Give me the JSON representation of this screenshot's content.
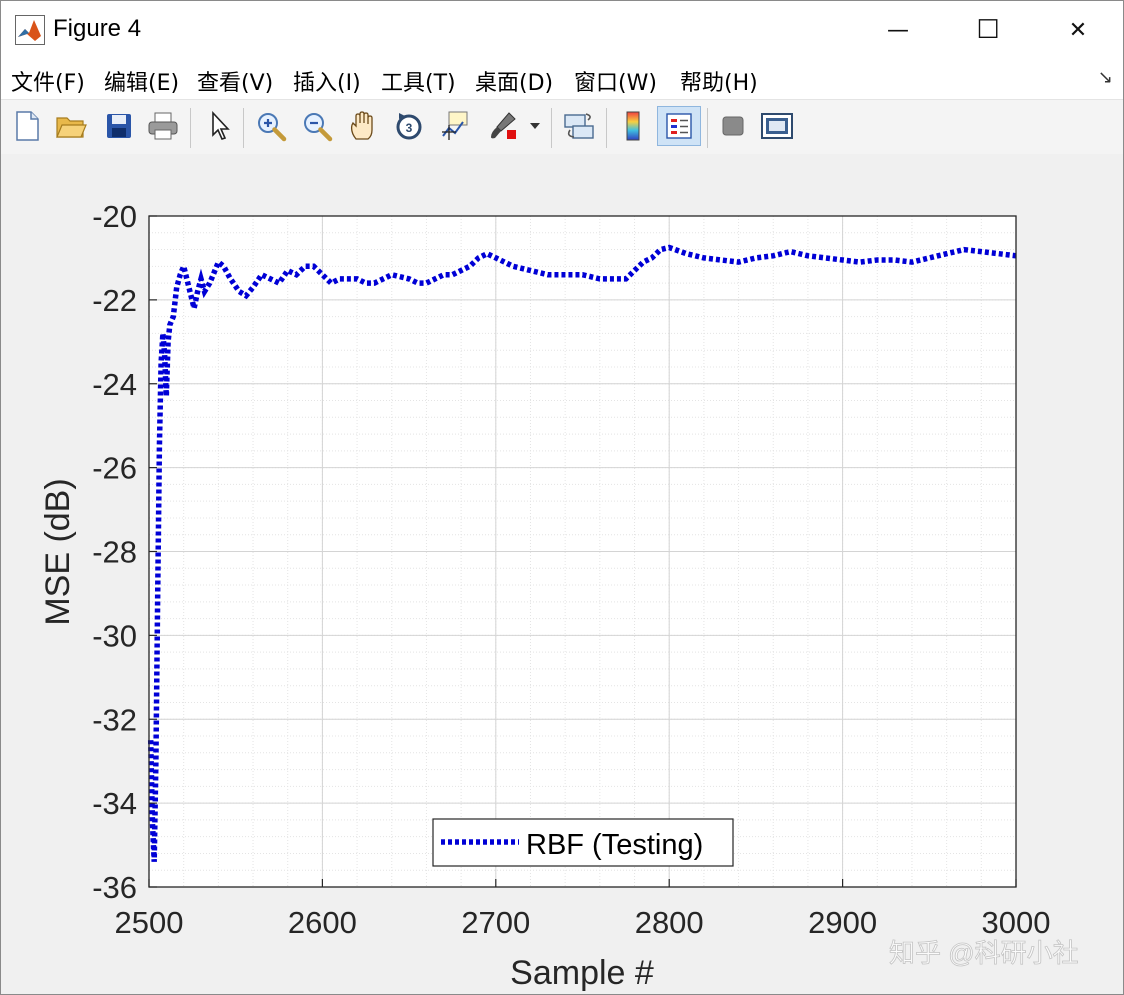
{
  "window": {
    "title": "Figure 4",
    "controls": {
      "minimize": "—",
      "maximize": "☐",
      "close": "✕"
    }
  },
  "menubar": {
    "items": [
      "文件(F)",
      "编辑(E)",
      "查看(V)",
      "插入(I)",
      "工具(T)",
      "桌面(D)",
      "窗口(W)",
      "帮助(H)"
    ],
    "overflow_icon": "↘"
  },
  "toolbar": {
    "icons": [
      "new-figure-icon",
      "open-icon",
      "save-icon",
      "print-icon",
      "pointer-icon",
      "zoom-in-icon",
      "zoom-out-icon",
      "pan-icon",
      "rotate-3d-icon",
      "data-cursor-icon",
      "brush-icon",
      "link-plot-icon",
      "colorbar-icon",
      "legend-icon",
      "hide-tools-icon",
      "dock-icon"
    ]
  },
  "chart_data": {
    "type": "line",
    "title": "",
    "xlabel": "Sample #",
    "ylabel": "MSE (dB)",
    "xlim": [
      2500,
      3000
    ],
    "ylim": [
      -36,
      -20
    ],
    "xticks": [
      "2500",
      "2600",
      "2700",
      "2800",
      "2900",
      "3000"
    ],
    "yticks": [
      "-20",
      "-22",
      "-24",
      "-26",
      "-28",
      "-30",
      "-32",
      "-34",
      "-36"
    ],
    "grid": true,
    "minor_grid": true,
    "legend_position": "bottom",
    "line_color": "#0000d6",
    "line_style": "dotted",
    "series": [
      {
        "name": "RBF (Testing)",
        "x": [
          2501,
          2502,
          2503,
          2504,
          2505,
          2506,
          2507,
          2508,
          2509,
          2510,
          2511,
          2512,
          2514,
          2516,
          2518,
          2520,
          2523,
          2526,
          2528,
          2530,
          2532,
          2535,
          2537,
          2540,
          2543,
          2547,
          2552,
          2556,
          2560,
          2565,
          2570,
          2575,
          2580,
          2585,
          2590,
          2595,
          2600,
          2605,
          2610,
          2615,
          2620,
          2625,
          2630,
          2640,
          2650,
          2655,
          2660,
          2665,
          2670,
          2675,
          2680,
          2685,
          2690,
          2695,
          2700,
          2705,
          2710,
          2720,
          2730,
          2740,
          2750,
          2760,
          2770,
          2775,
          2780,
          2785,
          2790,
          2795,
          2800,
          2810,
          2820,
          2830,
          2840,
          2850,
          2860,
          2870,
          2880,
          2890,
          2900,
          2910,
          2920,
          2930,
          2940,
          2950,
          2960,
          2970,
          2980,
          2990,
          3000
        ],
        "y": [
          -32.5,
          -34.5,
          -35.4,
          -33.0,
          -29.0,
          -25.5,
          -23.5,
          -22.8,
          -23.3,
          -24.3,
          -23.0,
          -22.6,
          -22.4,
          -21.7,
          -21.4,
          -21.2,
          -21.7,
          -22.2,
          -21.8,
          -21.5,
          -21.8,
          -21.6,
          -21.4,
          -21.1,
          -21.2,
          -21.5,
          -21.8,
          -21.9,
          -21.7,
          -21.4,
          -21.5,
          -21.6,
          -21.3,
          -21.4,
          -21.2,
          -21.2,
          -21.4,
          -21.6,
          -21.5,
          -21.5,
          -21.5,
          -21.6,
          -21.6,
          -21.4,
          -21.5,
          -21.6,
          -21.6,
          -21.5,
          -21.4,
          -21.4,
          -21.3,
          -21.2,
          -21.0,
          -20.9,
          -21.0,
          -21.1,
          -21.2,
          -21.3,
          -21.4,
          -21.4,
          -21.4,
          -21.5,
          -21.5,
          -21.5,
          -21.3,
          -21.1,
          -21.0,
          -20.8,
          -20.75,
          -20.9,
          -21.0,
          -21.05,
          -21.1,
          -21.0,
          -20.95,
          -20.85,
          -20.95,
          -21.0,
          -21.05,
          -21.1,
          -21.05,
          -21.05,
          -21.1,
          -21.0,
          -20.9,
          -20.8,
          -20.85,
          -20.9,
          -20.95
        ]
      }
    ]
  },
  "watermark": "知乎 @科研小社"
}
